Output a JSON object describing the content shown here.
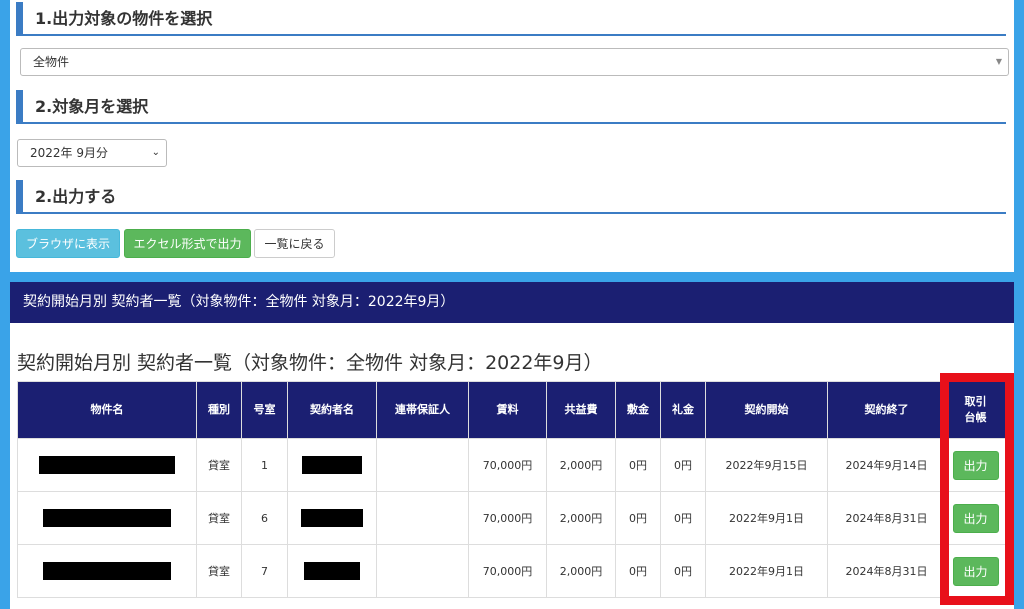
{
  "sections": {
    "s1_title": "1.出力対象の物件を選択",
    "s2_title": "2.対象月を選択",
    "s3_title": "2.出力する"
  },
  "property_select": {
    "value": "全物件"
  },
  "month_select": {
    "value": "2022年 9月分"
  },
  "buttons": {
    "browser": "ブラウザに表示",
    "excel": "エクセル形式で出力",
    "back": "一覧に戻る"
  },
  "result": {
    "bar_title": "契約開始月別 契約者一覧（対象物件：全物件 対象月：2022年9月）",
    "title": "契約開始月別 契約者一覧（対象物件：全物件 対象月：2022年9月）"
  },
  "table": {
    "headers": [
      "物件名",
      "種別",
      "号室",
      "契約者名",
      "連帯保証人",
      "賃料",
      "共益費",
      "敷金",
      "礼金",
      "契約開始",
      "契約終了",
      "取引\n台帳"
    ],
    "rows": [
      {
        "kind": "貸室",
        "room": "1",
        "guarantor": "",
        "rent": "70,000円",
        "common_fee": "2,000円",
        "deposit": "0円",
        "key_money": "0円",
        "start": "2022年9月15日",
        "end": "2024年9月14日",
        "action": "出力"
      },
      {
        "kind": "貸室",
        "room": "6",
        "guarantor": "",
        "rent": "70,000円",
        "common_fee": "2,000円",
        "deposit": "0円",
        "key_money": "0円",
        "start": "2022年9月1日",
        "end": "2024年8月31日",
        "action": "出力"
      },
      {
        "kind": "貸室",
        "room": "7",
        "guarantor": "",
        "rent": "70,000円",
        "common_fee": "2,000円",
        "deposit": "0円",
        "key_money": "0円",
        "start": "2022年9月1日",
        "end": "2024年8月31日",
        "action": "出力"
      }
    ]
  },
  "colors": {
    "page_bg": "#3aa3e8",
    "navy": "#1b1f72",
    "accent_blue": "#3b7cc4",
    "highlight_red": "#e8101a",
    "btn_green": "#5cb85c",
    "btn_info": "#5bc0de"
  }
}
